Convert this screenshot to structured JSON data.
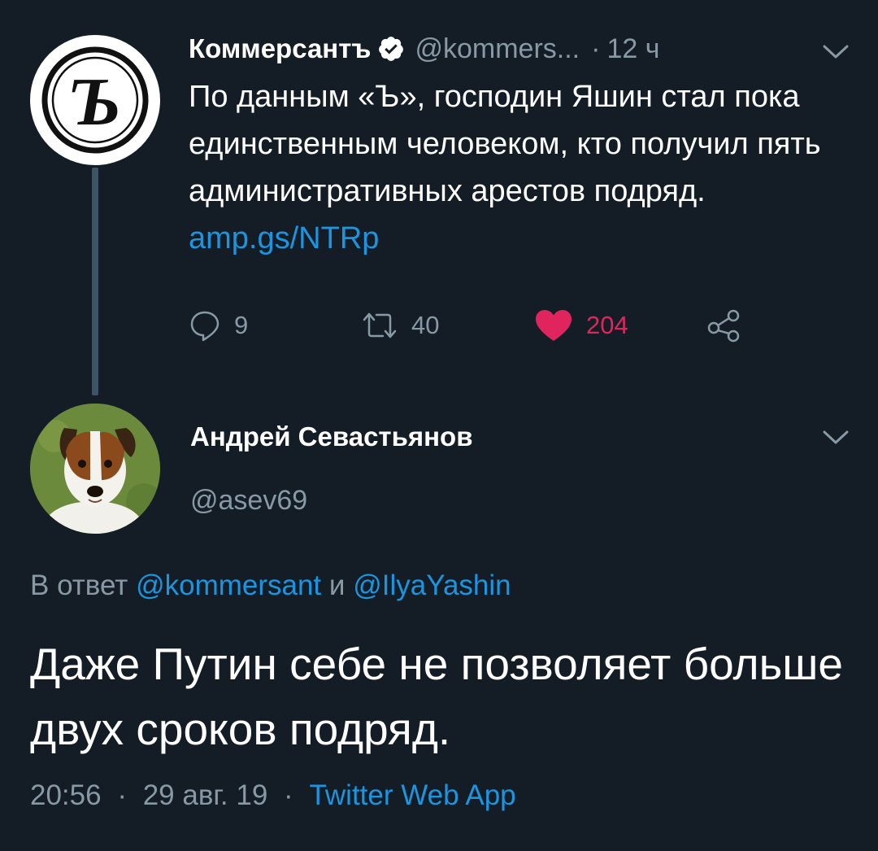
{
  "parent_tweet": {
    "display_name": "Коммерсантъ",
    "verified_icon": "verified-badge-icon",
    "handle": "@kommers...",
    "dot": "·",
    "time": "12 ч",
    "text": "По данным «Ъ», господин Яшин стал пока единственным человеком, кто получил пять административных арестов подряд.",
    "link": "amp.gs/NTRp",
    "avatar_glyph": "Ъ",
    "actions": {
      "reply_icon": "reply-icon",
      "reply_count": "9",
      "retweet_icon": "retweet-icon",
      "retweet_count": "40",
      "like_icon": "heart-icon",
      "like_count": "204",
      "share_icon": "share-icon"
    }
  },
  "reply_tweet": {
    "display_name": "Андрей Севастьянов",
    "handle": "@asev69",
    "reply_to_prefix": "В ответ",
    "reply_to_user1": "@kommersant",
    "reply_to_and": "и",
    "reply_to_user2": "@IlyaYashin",
    "text": "Даже Путин себе не позволяет больше двух сроков подряд.",
    "time": "20:56",
    "date": "29 авг. 19",
    "sep": "·",
    "client": "Twitter Web App"
  },
  "colors": {
    "background": "#141d26",
    "primary_text": "#ffffff",
    "secondary_text": "#8899a6",
    "link": "#1b95e0",
    "like": "#e0245e",
    "thread_line": "#3d5466"
  }
}
